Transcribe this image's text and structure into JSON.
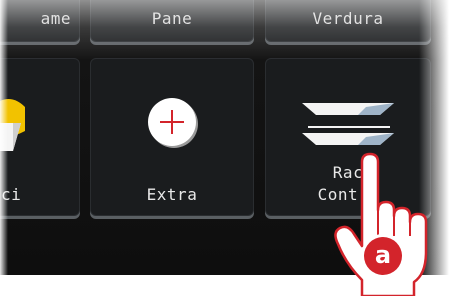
{
  "top_row": {
    "left_partial_label": "ame",
    "middle_label": "Pane",
    "right_label": "Verdura"
  },
  "main_row": {
    "left_partial_label": "ci",
    "middle_label": "Extra",
    "right_label_line1": "Rac",
    "right_label_line2": "Cont l"
  },
  "icons": {
    "extra": "plus-circle-icon",
    "raccolta": "stacked-plates-icon",
    "left": "food-bowl-icon",
    "pointer": "pointing-hand-icon"
  },
  "badge": {
    "letter": "a"
  },
  "colors": {
    "tile_bg": "#1a1c1e",
    "accent_red": "#d3242b",
    "text": "#e8e8e8"
  }
}
